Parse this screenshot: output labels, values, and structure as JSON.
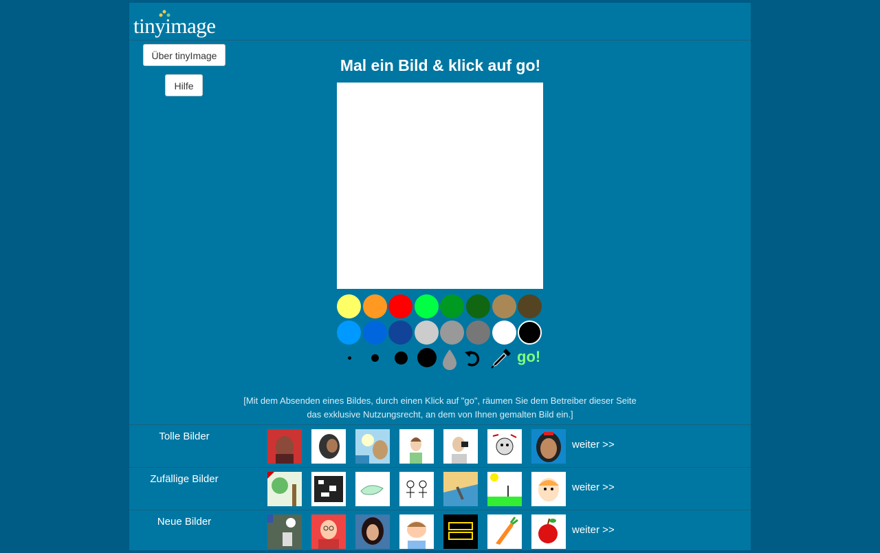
{
  "logo": {
    "text": "tinyimage"
  },
  "sidebar": {
    "about_label": "Über tinyImage",
    "help_label": "Hilfe"
  },
  "main": {
    "title": "Mal ein Bild & klick auf go!",
    "go_label": "go!",
    "disclaimer": "[Mit dem Absenden eines Bildes, durch einen Klick auf \"go\", räumen Sie dem Betreiber dieser Seite das exklusive Nutzungsrecht, an dem von Ihnen gemalten Bild ein.]"
  },
  "palette": {
    "row1": [
      "#ffff66",
      "#ff9922",
      "#ff0000",
      "#00ff44",
      "#009922",
      "#116611",
      "#aa8855",
      "#554422"
    ],
    "row2": [
      "#0099ff",
      "#0066dd",
      "#114499",
      "#cccccc",
      "#999999",
      "#777777",
      "#ffffff",
      "#000000"
    ],
    "selected": "#000000"
  },
  "tools": [
    "brush-size-1",
    "brush-size-2",
    "brush-size-3",
    "brush-size-4",
    "fill-tool",
    "undo-tool",
    "eyedropper-tool"
  ],
  "galleries": [
    {
      "title": "Tolle Bilder",
      "more_label": "weiter >>"
    },
    {
      "title": "Zufällige Bilder",
      "more_label": "weiter >>"
    },
    {
      "title": "Neue Bilder",
      "more_label": "weiter >>"
    }
  ]
}
